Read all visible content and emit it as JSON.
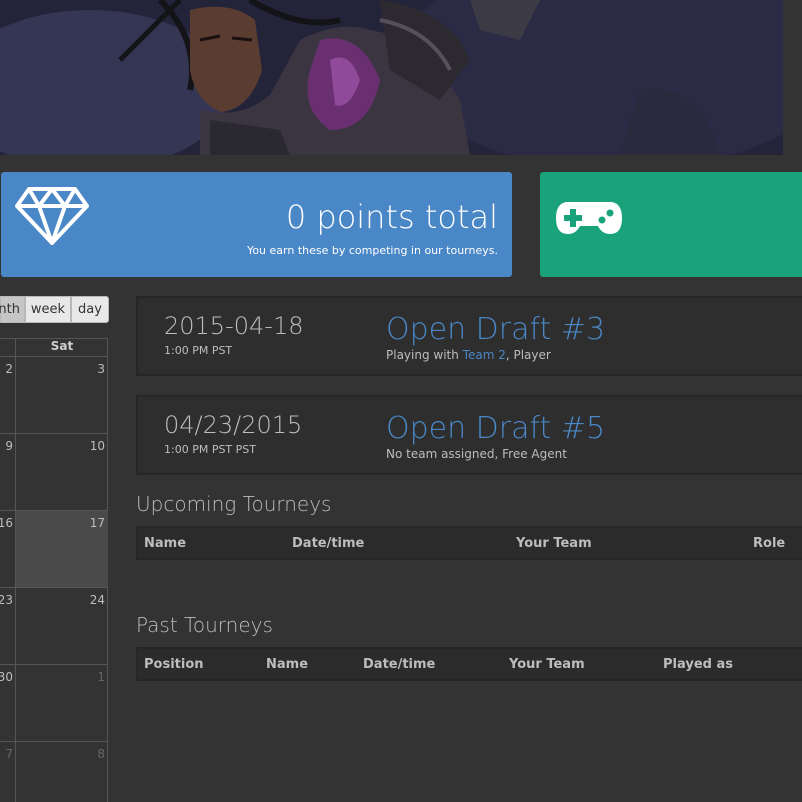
{
  "points_panel": {
    "total": "0 points total",
    "caption": "You earn these by competing in our tourneys.",
    "icon": "diamond-icon",
    "color": "#4a87c6"
  },
  "games_panel": {
    "icon": "gamepad-icon",
    "color": "#1aa37b"
  },
  "calendar": {
    "views": [
      "nth",
      "week",
      "day"
    ],
    "day_header": "Sat",
    "left_days": [
      "2",
      "9",
      "16",
      "23",
      "30",
      "7"
    ],
    "sat_days": [
      "3",
      "10",
      "17",
      "24",
      "1",
      "8"
    ]
  },
  "events": [
    {
      "date": "2015-04-18",
      "time": "1:00 PM PST",
      "title": "Open Draft #3",
      "sub_prefix": "Playing with ",
      "team_link": "Team 2",
      "sub_suffix": ", Player"
    },
    {
      "date": "04/23/2015",
      "time": "1:00 PM PST PST",
      "title": "Open Draft #5",
      "sub_text": "No team assigned, Free Agent"
    }
  ],
  "upcoming": {
    "title": "Upcoming Tourneys",
    "columns": [
      "Name",
      "Date/time",
      "Your Team",
      "Role"
    ]
  },
  "past": {
    "title": "Past Tourneys",
    "columns": [
      "Position",
      "Name",
      "Date/time",
      "Your Team",
      "Played as"
    ]
  }
}
